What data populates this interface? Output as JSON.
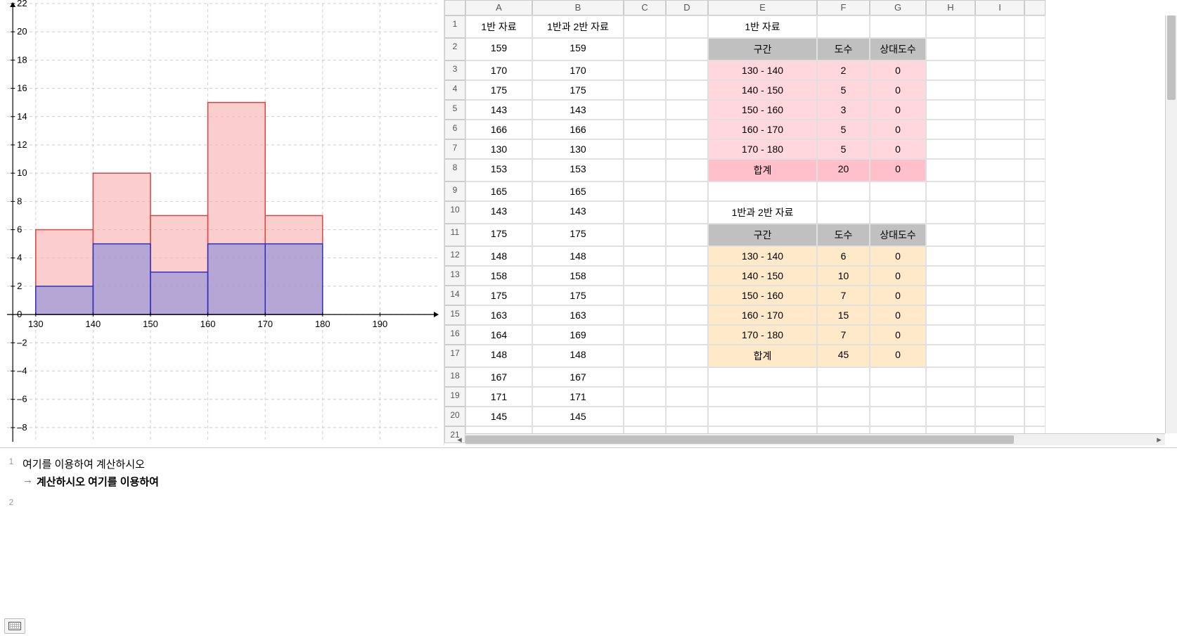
{
  "chart_data": {
    "type": "histogram",
    "title": "",
    "xlabel": "",
    "ylabel": "",
    "xlim": [
      125,
      200
    ],
    "ylim": [
      -9,
      22
    ],
    "x_ticks": [
      130,
      140,
      150,
      160,
      170,
      180,
      190
    ],
    "y_ticks": [
      -8,
      -6,
      -4,
      -2,
      0,
      2,
      4,
      6,
      8,
      10,
      12,
      14,
      16,
      18,
      20,
      22
    ],
    "bins": [
      130,
      140,
      150,
      160,
      170,
      180
    ],
    "series": [
      {
        "name": "1반과 2반 자료",
        "color_fill": "#f9b3b3",
        "color_stroke": "#d94545",
        "values": [
          6,
          10,
          7,
          15,
          7
        ]
      },
      {
        "name": "1반 자료",
        "color_fill": "#9090d8",
        "color_stroke": "#3030c0",
        "values": [
          2,
          5,
          3,
          5,
          5
        ]
      }
    ]
  },
  "spreadsheet": {
    "columns": [
      "A",
      "B",
      "C",
      "D",
      "E",
      "F",
      "G",
      "H",
      "I",
      ""
    ],
    "rows": [
      {
        "n": 1,
        "A": "1반 자료",
        "B": "1반과 2반 자료",
        "E": "1반 자료"
      },
      {
        "n": 2,
        "A": "159",
        "B": "159",
        "E": "구간",
        "F": "도수",
        "G": "상대도수",
        "style_EFG": "gray"
      },
      {
        "n": 3,
        "A": "170",
        "B": "170",
        "E": "130 - 140",
        "F": "2",
        "G": "0",
        "style_EFG": "lightpink"
      },
      {
        "n": 4,
        "A": "175",
        "B": "175",
        "E": "140 - 150",
        "F": "5",
        "G": "0",
        "style_EFG": "lightpink"
      },
      {
        "n": 5,
        "A": "143",
        "B": "143",
        "E": "150 - 160",
        "F": "3",
        "G": "0",
        "style_EFG": "lightpink"
      },
      {
        "n": 6,
        "A": "166",
        "B": "166",
        "E": "160 - 170",
        "F": "5",
        "G": "0",
        "style_EFG": "lightpink"
      },
      {
        "n": 7,
        "A": "130",
        "B": "130",
        "E": "170 - 180",
        "F": "5",
        "G": "0",
        "style_EFG": "lightpink"
      },
      {
        "n": 8,
        "A": "153",
        "B": "153",
        "E": "합계",
        "F": "20",
        "G": "0",
        "style_EFG": "pink"
      },
      {
        "n": 9,
        "A": "165",
        "B": "165"
      },
      {
        "n": 10,
        "A": "143",
        "B": "143",
        "E": "1반과 2반 자료"
      },
      {
        "n": 11,
        "A": "175",
        "B": "175",
        "E": "구간",
        "F": "도수",
        "G": "상대도수",
        "style_EFG": "gray"
      },
      {
        "n": 12,
        "A": "148",
        "B": "148",
        "E": "130 - 140",
        "F": "6",
        "G": "0",
        "style_EFG": "cream"
      },
      {
        "n": 13,
        "A": "158",
        "B": "158",
        "E": "140 - 150",
        "F": "10",
        "G": "0",
        "style_EFG": "cream"
      },
      {
        "n": 14,
        "A": "175",
        "B": "175",
        "E": "150 - 160",
        "F": "7",
        "G": "0",
        "style_EFG": "cream"
      },
      {
        "n": 15,
        "A": "163",
        "B": "163",
        "E": "160 - 170",
        "F": "15",
        "G": "0",
        "style_EFG": "cream"
      },
      {
        "n": 16,
        "A": "164",
        "B": "169",
        "E": "170 - 180",
        "F": "7",
        "G": "0",
        "style_EFG": "cream"
      },
      {
        "n": 17,
        "A": "148",
        "B": "148",
        "E": "합계",
        "F": "45",
        "G": "0",
        "style_EFG": "cream"
      },
      {
        "n": 18,
        "A": "167",
        "B": "167"
      },
      {
        "n": 19,
        "A": "171",
        "B": "171"
      },
      {
        "n": 20,
        "A": "145",
        "B": "145"
      },
      {
        "n": 21
      }
    ]
  },
  "input_bar": {
    "row1_label": "1",
    "row1_text": "여기를 이용하여 계산하시오",
    "row1_preview": "계산하시오 여기를 이용하여",
    "row2_label": "2"
  }
}
